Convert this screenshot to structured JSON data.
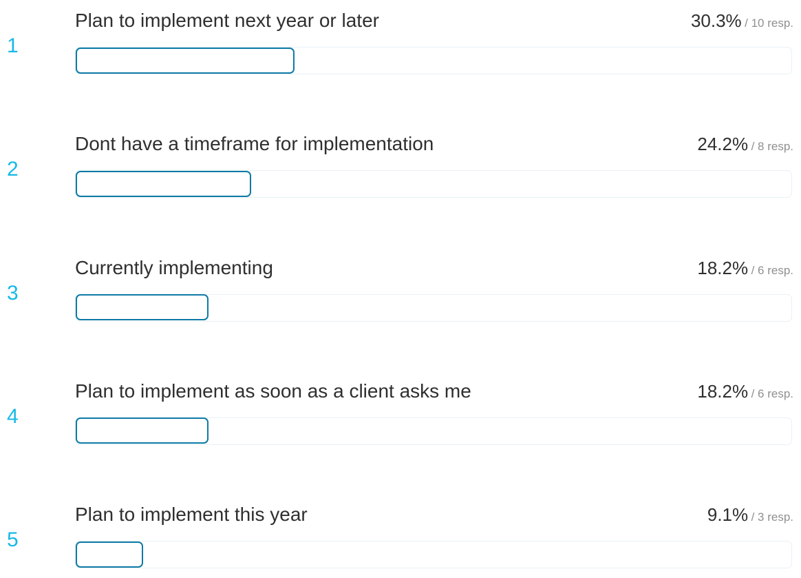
{
  "chart_data": {
    "type": "bar",
    "categories": [
      "Plan to implement next year or later",
      "Dont have a timeframe for implementation",
      "Currently implementing",
      "Plan to implement as soon as a client asks me",
      "Plan to implement this year"
    ],
    "values": [
      30.3,
      24.2,
      18.2,
      18.2,
      9.1
    ],
    "percent_labels": [
      "30.3%",
      "24.2%",
      "18.2%",
      "18.2%",
      "9.1%"
    ],
    "responses_labels": [
      "/ 10 resp.",
      "/ 8 resp.",
      "/ 6 resp.",
      "/ 6 resp.",
      "/ 3 resp."
    ],
    "ranks": [
      "1",
      "2",
      "3",
      "4",
      "5"
    ],
    "xlim": [
      0,
      100
    ],
    "orientation": "horizontal",
    "colors": {
      "rank": "#16b9e6",
      "bar_outline": "#0d7aa6",
      "track_outline": "#e7f1f5"
    }
  }
}
